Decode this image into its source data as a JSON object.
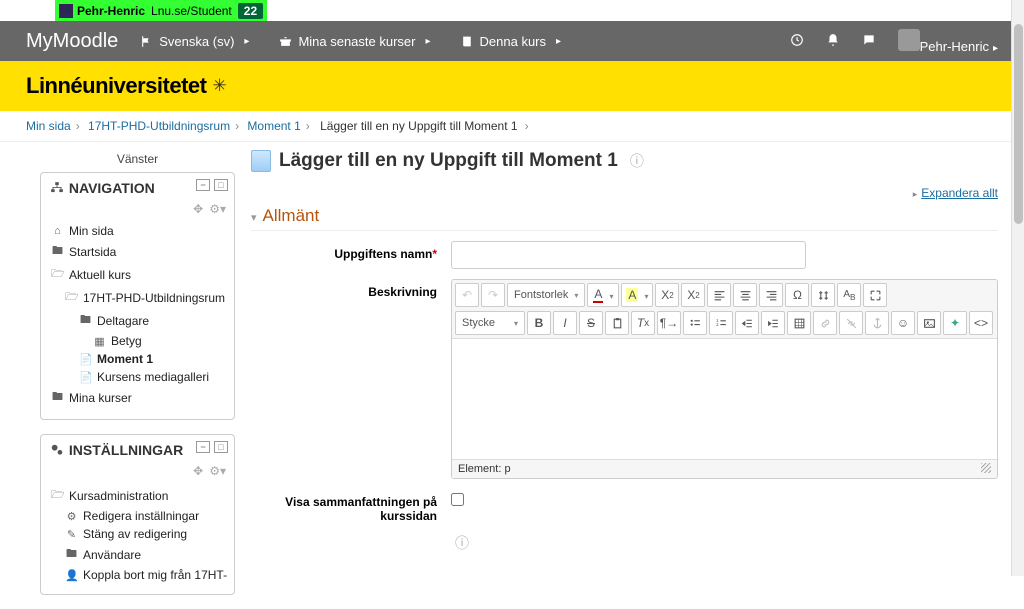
{
  "greenbar": {
    "name": "Pehr-Henric",
    "url": "Lnu.se/Student",
    "count": "22"
  },
  "topnav": {
    "brand": "MyMoodle",
    "menu": [
      {
        "icon": "flag",
        "label": "Svenska (sv)"
      },
      {
        "icon": "briefcase",
        "label": "Mina senaste kurser"
      },
      {
        "icon": "book",
        "label": "Denna kurs"
      }
    ],
    "user": "Pehr-Henric"
  },
  "banner": {
    "logo": "Linnéuniversitetet"
  },
  "crumbs": [
    "Min sida",
    "17HT-PHD-Utbildningsrum",
    "Moment 1",
    "Lägger till en ny Uppgift till Moment 1"
  ],
  "dock_label": "Vänster",
  "nav_block": {
    "title": "NAVIGATION",
    "items": [
      {
        "icon": "home",
        "label": "Min sida",
        "indent": 0
      },
      {
        "icon": "folder",
        "label": "Startsida",
        "indent": 0
      },
      {
        "icon": "folder-open",
        "label": "Aktuell kurs",
        "indent": 0
      },
      {
        "icon": "folder-open",
        "label": "17HT-PHD-Utbildningsrum",
        "indent": 1
      },
      {
        "icon": "folder",
        "label": "Deltagare",
        "indent": 2
      },
      {
        "icon": "grid",
        "label": "Betyg",
        "indent": 3
      },
      {
        "icon": "file",
        "label": "Moment 1",
        "indent": 2,
        "bold": true
      },
      {
        "icon": "file",
        "label": "Kursens mediagalleri",
        "indent": 2
      },
      {
        "icon": "folder",
        "label": "Mina kurser",
        "indent": 0
      }
    ]
  },
  "settings_block": {
    "title": "INSTÄLLNINGAR",
    "items": [
      {
        "icon": "folder-open",
        "label": "Kursadministration",
        "indent": 0
      },
      {
        "icon": "gear",
        "label": "Redigera inställningar",
        "indent": 1
      },
      {
        "icon": "pencil",
        "label": "Stäng av redigering",
        "indent": 1
      },
      {
        "icon": "folder",
        "label": "Användare",
        "indent": 1
      },
      {
        "icon": "user",
        "label": "Koppla bort mig från 17HT-",
        "indent": 1
      }
    ]
  },
  "page": {
    "title": "Lägger till en ny Uppgift till Moment 1",
    "expand": "Expandera allt",
    "section": "Allmänt",
    "label_name": "Uppgiftens namn",
    "label_desc": "Beskrivning",
    "font_size": "Fontstorlek",
    "paragraph": "Stycke",
    "path": "Element: p",
    "show_summary": "Visa sammanfattningen på kurssidan"
  }
}
